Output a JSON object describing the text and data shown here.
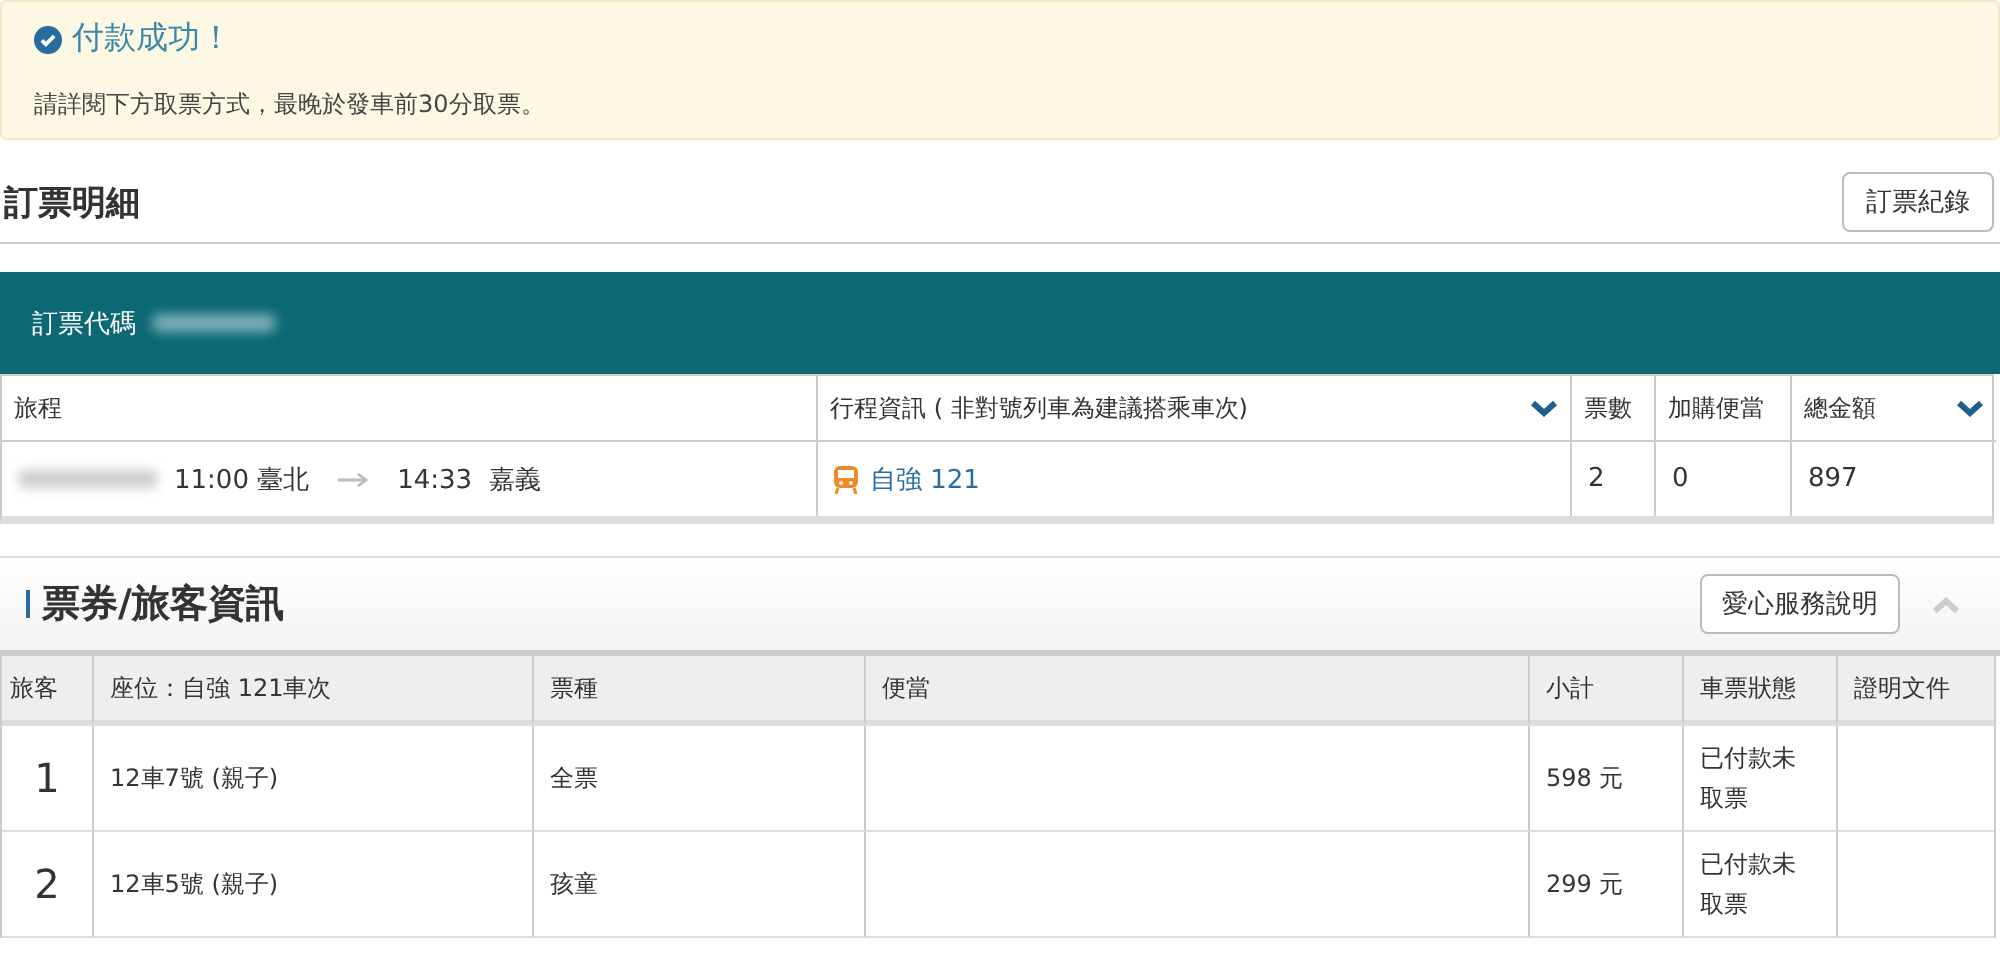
{
  "alert": {
    "title": "付款成功！",
    "message": "請詳閱下方取票方式，最晚於發車前30分取票。"
  },
  "booking": {
    "heading": "訂票明細",
    "history_button": "訂票紀錄",
    "code_label": "訂票代碼",
    "columns": [
      {
        "label": "旅程",
        "dropdown": false
      },
      {
        "label": "行程資訊 ( 非對號列車為建議搭乘車次)",
        "dropdown": true
      },
      {
        "label": "票數",
        "dropdown": false
      },
      {
        "label": "加購便當",
        "dropdown": false
      },
      {
        "label": "總金額",
        "dropdown": true
      }
    ],
    "row": {
      "depart_time": "11:00",
      "from": "臺北",
      "arrive_time": "14:33",
      "to": "嘉義",
      "train": "自強 121",
      "tickets": "2",
      "bento": "0",
      "total": "897"
    }
  },
  "passengers": {
    "heading": "票券/旅客資訊",
    "help_button": "愛心服務說明",
    "expanded": true,
    "columns": [
      "旅客",
      "座位：自強 121車次",
      "票種",
      "便當",
      "小計",
      "車票狀態",
      "證明文件"
    ],
    "rows": [
      {
        "no": "1",
        "seat": "12車7號 (親子)",
        "ticket_type": "全票",
        "subtotal": "598 元",
        "status": "已付款未取票"
      },
      {
        "no": "2",
        "seat": "12車5號 (親子)",
        "ticket_type": "孩童",
        "subtotal": "299 元",
        "status": "已付款未取票"
      }
    ]
  }
}
